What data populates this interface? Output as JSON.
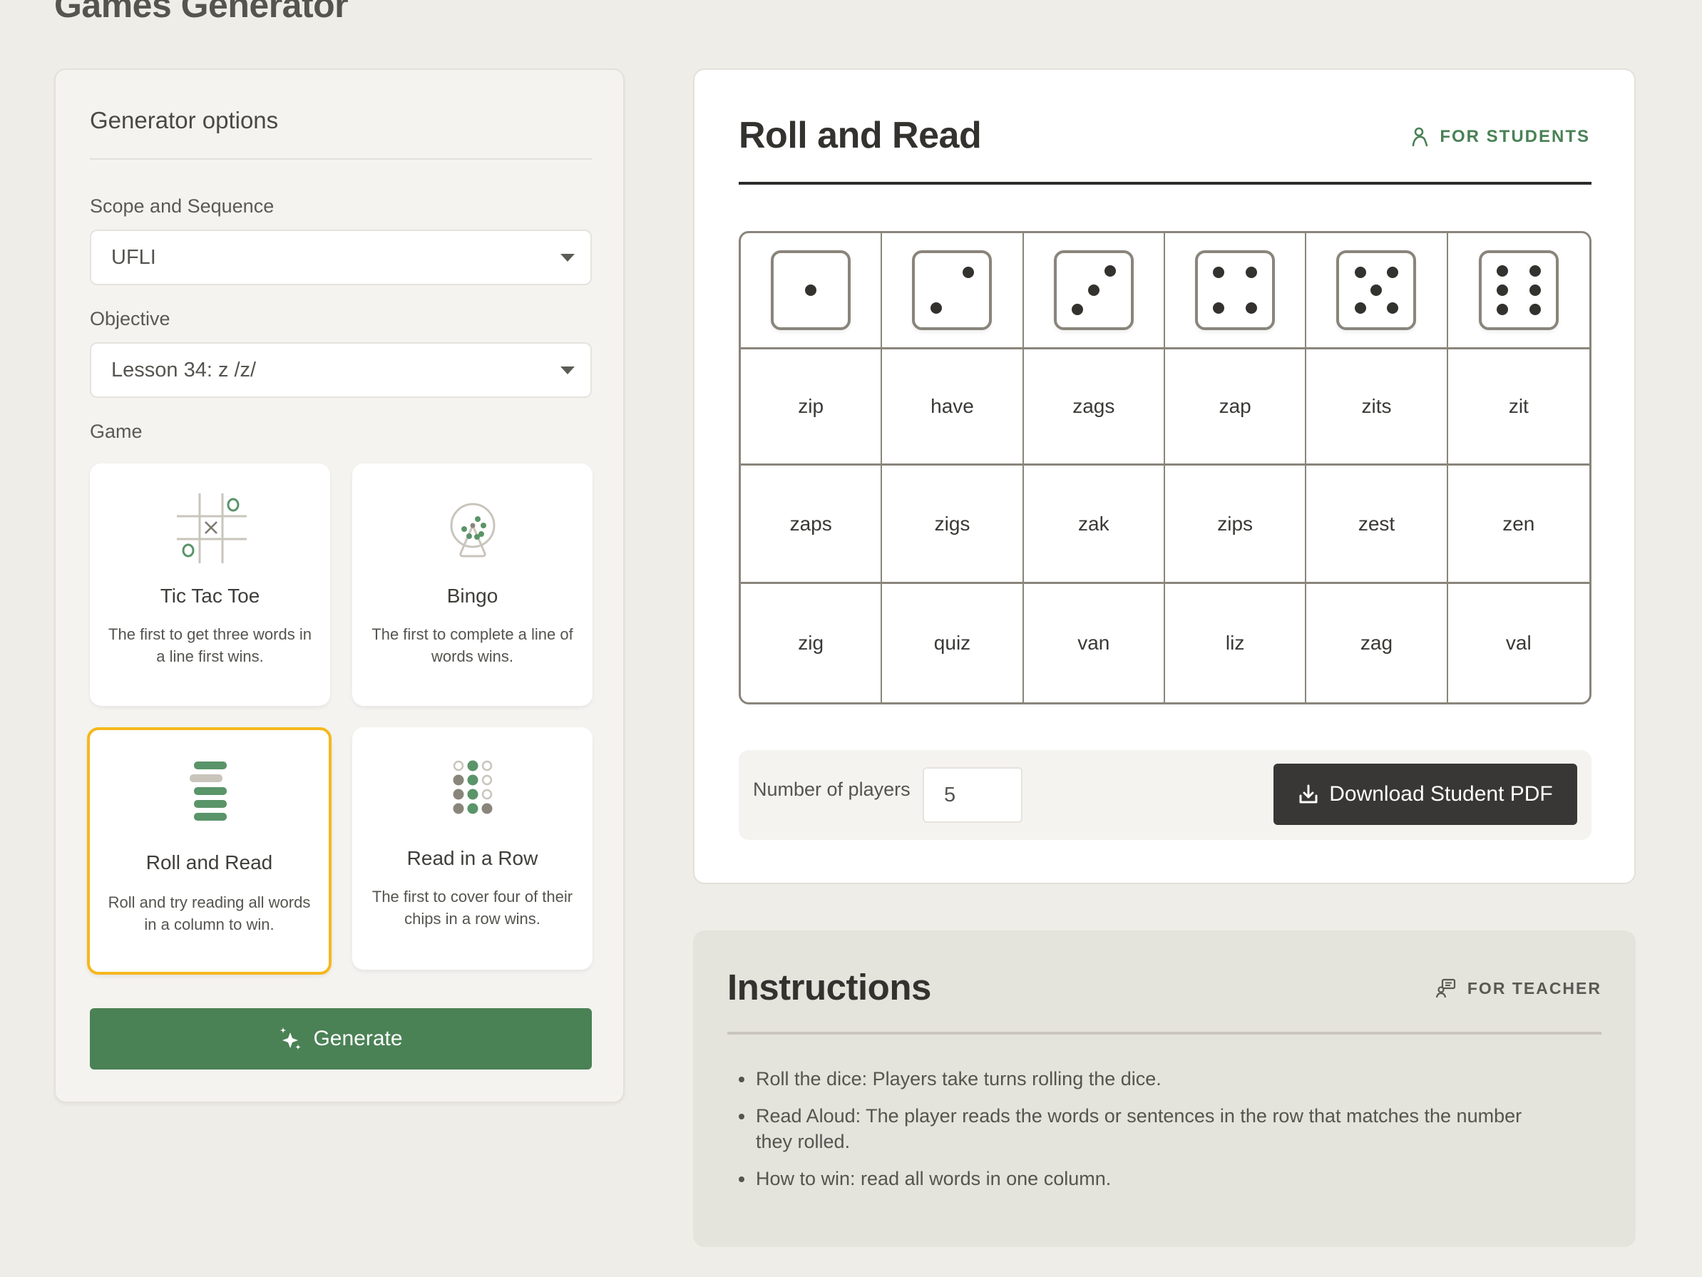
{
  "page": {
    "title": "Games Generator"
  },
  "generator": {
    "title": "Generator options",
    "scope": {
      "label": "Scope and Sequence",
      "value": "UFLI"
    },
    "objective": {
      "label": "Objective",
      "value": "Lesson 34: z /z/"
    },
    "game_label": "Game",
    "games": [
      {
        "name": "Tic Tac Toe",
        "description": "The first to get three words in a line first wins.",
        "icon": "tic-tac-toe-icon",
        "selected": false
      },
      {
        "name": "Bingo",
        "description": "The first to complete a line of words wins.",
        "icon": "bingo-cage-icon",
        "selected": false
      },
      {
        "name": "Roll and Read",
        "description": "Roll and try reading all words in a column to win.",
        "icon": "roll-and-read-icon",
        "selected": true
      },
      {
        "name": "Read in a Row",
        "description": "The first to cover four of their chips in a row wins.",
        "icon": "chips-grid-icon",
        "selected": false
      }
    ],
    "generate_label": "Generate"
  },
  "game_sheet": {
    "title": "Roll and Read",
    "audience_badge": "FOR STUDENTS",
    "dice": [
      1,
      2,
      3,
      4,
      5,
      6
    ],
    "rows": [
      [
        "zip",
        "have",
        "zags",
        "zap",
        "zits",
        "zit"
      ],
      [
        "zaps",
        "zigs",
        "zak",
        "zips",
        "zest",
        "zen"
      ],
      [
        "zig",
        "quiz",
        "van",
        "liz",
        "zag",
        "val"
      ]
    ],
    "players_label": "Number of players",
    "players_value": "5",
    "download_label": "Download Student PDF"
  },
  "instructions": {
    "title": "Instructions",
    "audience_badge": "FOR TEACHER",
    "items": [
      "Roll the dice: Players take turns rolling the dice.",
      "Read Aloud: The player reads the words or sentences in the row that matches the number they rolled.",
      "How to win: read all words in one column."
    ]
  },
  "colors": {
    "accent_green": "#4a8155",
    "selected_border": "#f4b81e",
    "dark_button": "#383735",
    "background": "#efede7"
  }
}
